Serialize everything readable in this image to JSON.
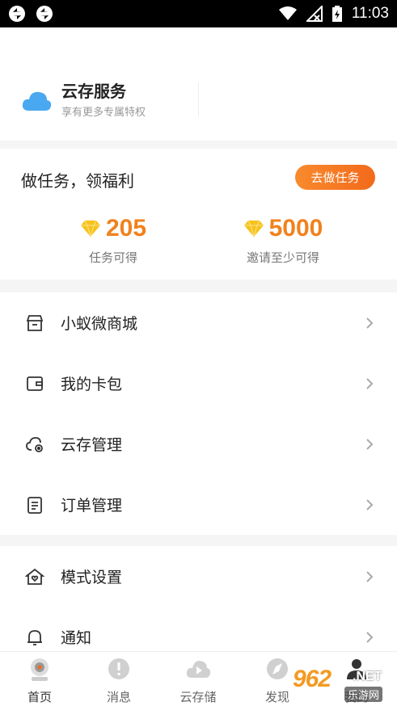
{
  "status_bar": {
    "time": "11:03",
    "left_icons": [
      "sync-icon",
      "sync-icon"
    ],
    "right_icons": [
      "wifi-icon",
      "no-signal-icon",
      "battery-icon"
    ]
  },
  "cloud_service": {
    "title": "云存服务",
    "subtitle": "享有更多专属特权",
    "icon": "cloud-icon"
  },
  "tasks": {
    "title": "做任务，领福利",
    "button_label": "去做任务",
    "stats": [
      {
        "value": "205",
        "label": "任务可得",
        "icon": "diamond-icon"
      },
      {
        "value": "5000",
        "label": "邀请至少可得",
        "icon": "diamond-icon"
      }
    ]
  },
  "menu_group_1": [
    {
      "label": "小蚁微商城",
      "icon": "shop-icon"
    },
    {
      "label": "我的卡包",
      "icon": "wallet-icon"
    },
    {
      "label": "云存管理",
      "icon": "cloud-settings-icon"
    },
    {
      "label": "订单管理",
      "icon": "order-icon"
    }
  ],
  "menu_group_2": [
    {
      "label": "模式设置",
      "icon": "home-heart-icon"
    },
    {
      "label": "通知",
      "icon": "bell-icon"
    }
  ],
  "tabs": [
    {
      "label": "首页",
      "icon": "camera-icon"
    },
    {
      "label": "消息",
      "icon": "message-icon"
    },
    {
      "label": "云存储",
      "icon": "cloud-play-icon"
    },
    {
      "label": "发现",
      "icon": "compass-icon"
    },
    {
      "label": "我的",
      "icon": "profile-icon"
    }
  ],
  "watermark": {
    "brand": "962",
    "suffix": ".NET",
    "sub": "乐游网"
  },
  "colors": {
    "accent": "#f0821e",
    "button_gradient_start": "#f98a2d",
    "button_gradient_end": "#f26a1b",
    "cloud_blue": "#4aa8f0",
    "gem_yellow": "#f6c21c"
  }
}
